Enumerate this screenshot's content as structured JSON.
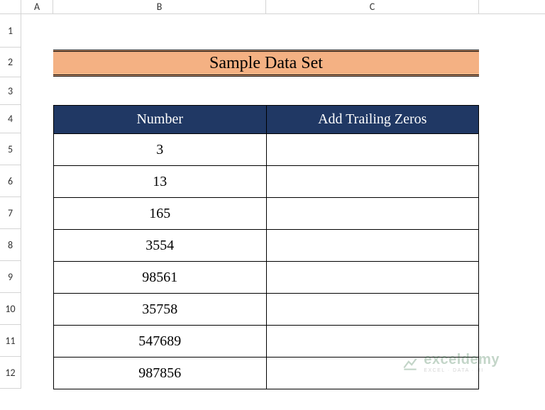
{
  "columns": {
    "A": "A",
    "B": "B",
    "C": "C"
  },
  "rows": {
    "r1": "1",
    "r2": "2",
    "r3": "3",
    "r4": "4",
    "r5": "5",
    "r6": "6",
    "r7": "7",
    "r8": "8",
    "r9": "9",
    "r10": "10",
    "r11": "11",
    "r12": "12"
  },
  "title": "Sample Data Set",
  "headers": {
    "number": "Number",
    "trailing": "Add Trailing Zeros"
  },
  "numbers": {
    "n0": "3",
    "n1": "13",
    "n2": "165",
    "n3": "3554",
    "n4": "98561",
    "n5": "35758",
    "n6": "547689",
    "n7": "987856"
  },
  "watermark": {
    "main": "exceldemy",
    "sub": "EXCEL · DATA · BI"
  },
  "chart_data": {
    "type": "table",
    "title": "Sample Data Set",
    "columns": [
      "Number",
      "Add Trailing Zeros"
    ],
    "rows": [
      [
        3,
        null
      ],
      [
        13,
        null
      ],
      [
        165,
        null
      ],
      [
        3554,
        null
      ],
      [
        98561,
        null
      ],
      [
        35758,
        null
      ],
      [
        547689,
        null
      ],
      [
        987856,
        null
      ]
    ]
  }
}
